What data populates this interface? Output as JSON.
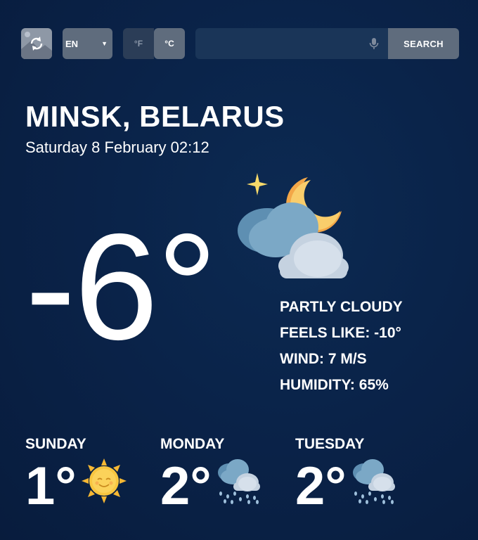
{
  "toolbar": {
    "language": "EN",
    "unit_f": "°F",
    "unit_c": "°C",
    "search_placeholder": "",
    "search_label": "SEARCH",
    "icons": [
      "refresh-background-icon",
      "microphone-icon"
    ]
  },
  "location": {
    "city": "MINSK, BELARUS",
    "datetime": "Saturday 8 February 02:12"
  },
  "current": {
    "temperature": "-6°",
    "condition": "PARTLY CLOUDY",
    "feels_like": "FEELS LIKE: -10°",
    "wind": "WIND: 7 M/S",
    "humidity": "HUMIDITY: 65%",
    "icon": "partly-cloudy-night-icon"
  },
  "forecast": [
    {
      "day": "SUNDAY",
      "temp": "1°",
      "icon": "sun-icon"
    },
    {
      "day": "MONDAY",
      "temp": "2°",
      "icon": "rain-cloud-icon"
    },
    {
      "day": "TUESDAY",
      "temp": "2°",
      "icon": "rain-cloud-icon"
    }
  ]
}
